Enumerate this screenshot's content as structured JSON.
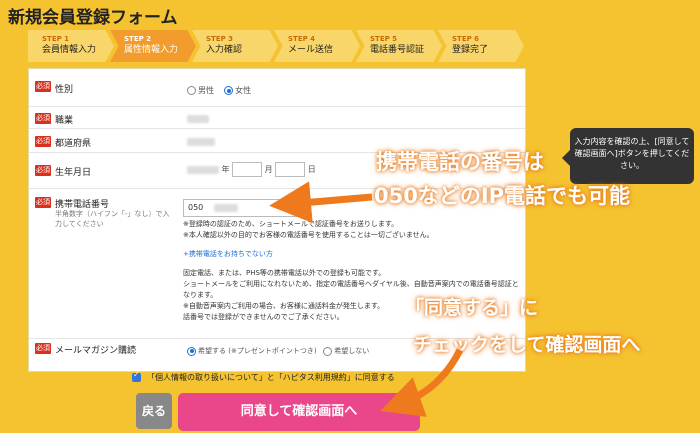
{
  "page_title": "新規会員登録フォーム",
  "steps": [
    {
      "num": "STEP 1",
      "label": "会員情報入力"
    },
    {
      "num": "STEP 2",
      "label": "属性情報入力"
    },
    {
      "num": "STEP 3",
      "label": "入力確認"
    },
    {
      "num": "STEP 4",
      "label": "メール送信"
    },
    {
      "num": "STEP 5",
      "label": "電話番号認証"
    },
    {
      "num": "STEP 6",
      "label": "登録完了"
    }
  ],
  "required_badge": "必須",
  "fields": {
    "gender": {
      "label": "性別",
      "options": [
        "男性",
        "女性"
      ],
      "selected": "女性"
    },
    "occupation": {
      "label": "職業"
    },
    "prefecture": {
      "label": "都道府県"
    },
    "birthdate": {
      "label": "生年月日",
      "year_unit": "年",
      "month_unit": "月",
      "day_unit": "日"
    },
    "phone": {
      "label": "携帯電話番号",
      "hint": "半角数字（ハイフン「-」なし）で入力してください",
      "value": "050",
      "note1": "※登録時の認証のため、ショートメールで認証番号をお送りします。",
      "note2": "※本人確認以外の目的でお客様の電話番号を使用することは一切ございません。",
      "link": "+携帯電話をお持ちでない方",
      "info1": "固定電話、または、PHS等の携帯電話以外での登録も可能です。",
      "info2": "ショートメールをご利用になれないため、指定の電話番号へダイヤル後、自動音声案内での電話番号認証となります。",
      "info3": "※自動音声案内ご利用の場合、お客様に通話料金が発生します。",
      "info4": "話番号では登録ができませんのでご了承ください。"
    },
    "newsletter": {
      "label": "メールマガジン購読",
      "options": [
        "希望する (※プレゼントポイントつき)",
        "希望しない"
      ],
      "selected": "希望する (※プレゼントポイントつき)"
    }
  },
  "consent_text": "「個人情報の取り扱いについて」と「ハピタス利用規約」に同意する",
  "back_label": "戻る",
  "agree_label": "同意して確認画面へ",
  "tooltip": "入力内容を確認の上、[同意して確認画面へ]ボタンを押してください。",
  "callouts": {
    "c1_line1": "携帯電話の番号は",
    "c1_line2": "050などのIP電話でも可能",
    "c2_line1": "「同意する」に",
    "c2_line2": "チェックをして確認画面へ"
  }
}
